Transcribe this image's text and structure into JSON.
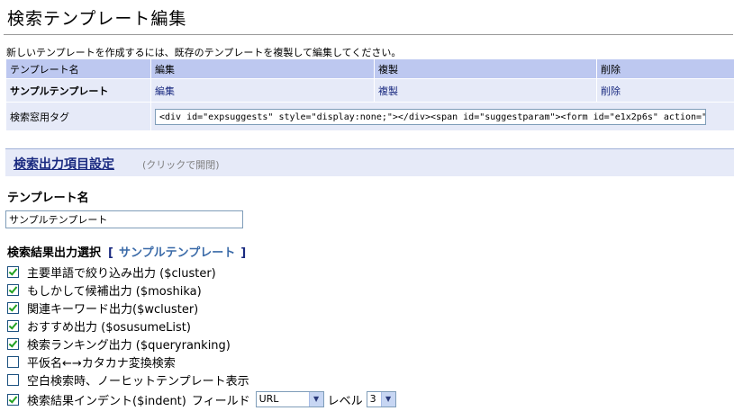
{
  "page_title": "検索テンプレート編集",
  "intro_text": "新しいテンプレートを作成するには、既存のテンプレートを複製して編集してください。",
  "table": {
    "headers": [
      "テンプレート名",
      "編集",
      "複製",
      "削除"
    ],
    "row": {
      "name": "サンプルテンプレート",
      "edit": "編集",
      "copy": "複製",
      "delete": "削除"
    },
    "tag_label": "検索窓用タグ",
    "tag_value": "<div id=\"expsuggests\" style=\"display:none;\"></div><span id=\"suggestparam\"><form id=\"e1x2p6s\" action=\"h"
  },
  "output_section": {
    "link": "検索出力項目設定",
    "hint": "(クリックで開閉)"
  },
  "template_name": {
    "label": "テンプレート名",
    "value": "サンプルテンプレート"
  },
  "result_output": {
    "label": "検索結果出力選択",
    "open_bracket": "[",
    "template_link": "サンプルテンプレート",
    "close_bracket": "]"
  },
  "options": [
    {
      "label": "主要単語で絞り込み出力 ($cluster)",
      "checked": true
    },
    {
      "label": "もしかして候補出力 ($moshika)",
      "checked": true
    },
    {
      "label": "関連キーワード出力($wcluster)",
      "checked": true
    },
    {
      "label": "おすすめ出力 ($osusumeList)",
      "checked": true
    },
    {
      "label": "検索ランキング出力 ($queryranking)",
      "checked": true
    },
    {
      "label": "平仮名←→カタカナ変換検索",
      "checked": false
    },
    {
      "label": "空白検索時、ノーヒットテンプレート表示",
      "checked": false
    },
    {
      "label": "検索結果インデント($indent)",
      "checked": true
    }
  ],
  "indent_controls": {
    "field_label": "フィールド",
    "field_value": "URL",
    "level_label": "レベル",
    "level_value": "3"
  }
}
